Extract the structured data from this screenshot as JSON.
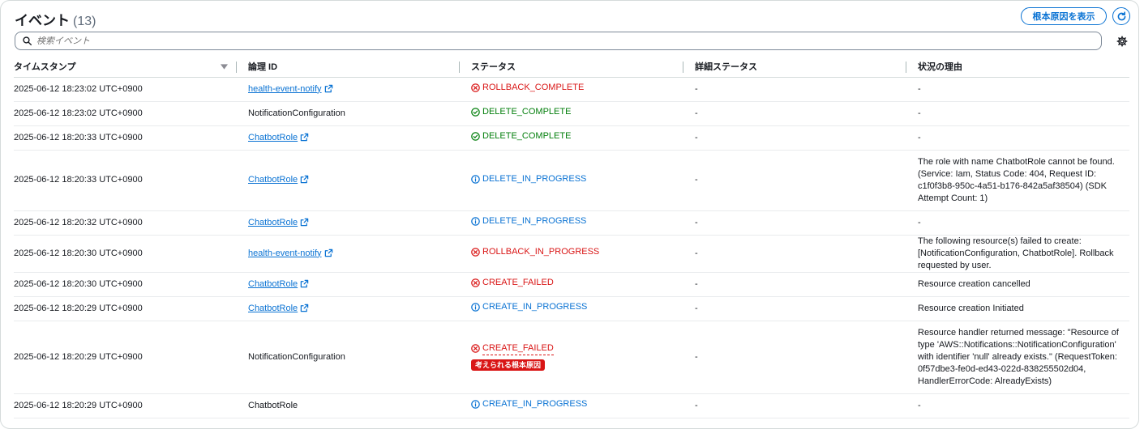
{
  "header": {
    "title": "イベント",
    "count": "(13)",
    "root_cause_button": "根本原因を表示"
  },
  "search": {
    "placeholder": "検索イベント"
  },
  "columns": [
    "タイムスタンプ",
    "論理 ID",
    "ステータス",
    "詳細ステータス",
    "状況の理由"
  ],
  "rows": [
    {
      "time": "2025-06-12 18:23:02 UTC+0900",
      "id": "health-event-notify",
      "link": true,
      "status": "ROLLBACK_COMPLETE",
      "kind": "error",
      "detail": "-",
      "reason": "-"
    },
    {
      "time": "2025-06-12 18:23:02 UTC+0900",
      "id": "NotificationConfiguration",
      "link": false,
      "status": "DELETE_COMPLETE",
      "kind": "success",
      "detail": "-",
      "reason": "-"
    },
    {
      "time": "2025-06-12 18:20:33 UTC+0900",
      "id": "ChatbotRole",
      "link": true,
      "status": "DELETE_COMPLETE",
      "kind": "success",
      "detail": "-",
      "reason": "-"
    },
    {
      "time": "2025-06-12 18:20:33 UTC+0900",
      "id": "ChatbotRole",
      "link": true,
      "status": "DELETE_IN_PROGRESS",
      "kind": "info",
      "detail": "-",
      "reason": "The role with name ChatbotRole cannot be found. (Service: Iam, Status Code: 404, Request ID: c1f0f3b8-950c-4a51-b176-842a5af38504) (SDK Attempt Count: 1)"
    },
    {
      "time": "2025-06-12 18:20:32 UTC+0900",
      "id": "ChatbotRole",
      "link": true,
      "status": "DELETE_IN_PROGRESS",
      "kind": "info",
      "detail": "-",
      "reason": "-"
    },
    {
      "time": "2025-06-12 18:20:30 UTC+0900",
      "id": "health-event-notify",
      "link": true,
      "status": "ROLLBACK_IN_PROGRESS",
      "kind": "error",
      "detail": "-",
      "reason": "The following resource(s) failed to create: [NotificationConfiguration, ChatbotRole]. Rollback requested by user."
    },
    {
      "time": "2025-06-12 18:20:30 UTC+0900",
      "id": "ChatbotRole",
      "link": true,
      "status": "CREATE_FAILED",
      "kind": "error",
      "detail": "-",
      "reason": "Resource creation cancelled"
    },
    {
      "time": "2025-06-12 18:20:29 UTC+0900",
      "id": "ChatbotRole",
      "link": true,
      "status": "CREATE_IN_PROGRESS",
      "kind": "info",
      "detail": "-",
      "reason": "Resource creation Initiated"
    },
    {
      "time": "2025-06-12 18:20:29 UTC+0900",
      "id": "NotificationConfiguration",
      "link": false,
      "status": "CREATE_FAILED",
      "kind": "error",
      "root_cause": "考えられる根本原因",
      "detail": "-",
      "reason": "Resource handler returned message: \"Resource of type 'AWS::Notifications::NotificationConfiguration' with identifier 'null' already exists.\" (RequestToken: 0f57dbe3-fe0d-ed43-022d-838255502d04, HandlerErrorCode: AlreadyExists)"
    },
    {
      "time": "2025-06-12 18:20:29 UTC+0900",
      "id": "ChatbotRole",
      "link": false,
      "status": "CREATE_IN_PROGRESS",
      "kind": "info",
      "detail": "-",
      "reason": "-"
    }
  ],
  "colors": {
    "link": "#0972d3",
    "error": "#d91515",
    "success": "#037f0c",
    "info": "#0972d3"
  }
}
